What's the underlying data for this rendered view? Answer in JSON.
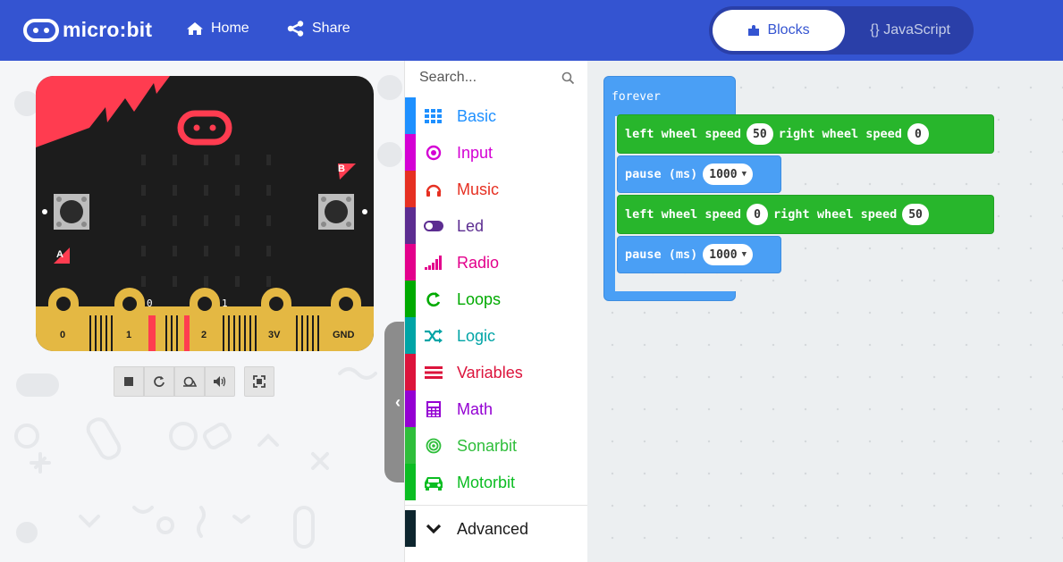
{
  "header": {
    "logo_text": "micro:bit",
    "home_label": "Home",
    "share_label": "Share",
    "blocks_label": "Blocks",
    "javascript_label": "{} JavaScript"
  },
  "simulator": {
    "pin_labels": [
      "0",
      "1",
      "2",
      "3V",
      "GND"
    ],
    "pin_numbers": [
      "0",
      "1"
    ],
    "button_a": "A",
    "button_b": "B"
  },
  "toolbox": {
    "search_placeholder": "Search...",
    "categories": [
      {
        "label": "Basic",
        "color": "#1e90ff"
      },
      {
        "label": "Input",
        "color": "#d400d4"
      },
      {
        "label": "Music",
        "color": "#e63022"
      },
      {
        "label": "Led",
        "color": "#5c2d91"
      },
      {
        "label": "Radio",
        "color": "#e3008c"
      },
      {
        "label": "Loops",
        "color": "#00aa00"
      },
      {
        "label": "Logic",
        "color": "#00a4a6"
      },
      {
        "label": "Variables",
        "color": "#dc143c"
      },
      {
        "label": "Math",
        "color": "#9400d3"
      },
      {
        "label": "Sonarbit",
        "color": "#2fbe3b"
      },
      {
        "label": "Motorbit",
        "color": "#0bbd22"
      }
    ],
    "advanced_label": "Advanced",
    "advanced_color": "#0d252e"
  },
  "workspace": {
    "forever_label": "forever",
    "statements": [
      {
        "type": "wheels",
        "left_label": "left wheel speed",
        "left_value": "50",
        "right_label": "right wheel speed",
        "right_value": "0"
      },
      {
        "type": "pause",
        "label": "pause (ms)",
        "value": "1000"
      },
      {
        "type": "wheels",
        "left_label": "left wheel speed",
        "left_value": "0",
        "right_label": "right wheel speed",
        "right_value": "50"
      },
      {
        "type": "pause",
        "label": "pause (ms)",
        "value": "1000"
      }
    ]
  },
  "colors": {
    "header_bg": "#3454d1",
    "block_blue": "#4a9ff5",
    "block_green": "#28b62c",
    "board_bg": "#1c1c1c",
    "board_accent": "#ff3c50",
    "pin_gold": "#e4b843"
  }
}
